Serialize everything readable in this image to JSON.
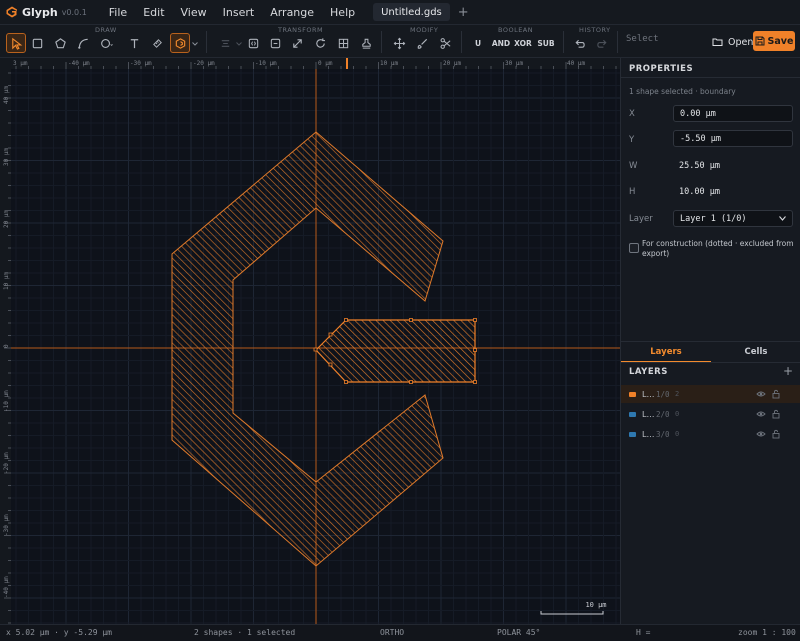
{
  "app": {
    "name": "Glyph",
    "version": "v0.0.1",
    "brand_color": "#f08129",
    "menu": [
      "File",
      "Edit",
      "View",
      "Insert",
      "Arrange",
      "Help"
    ],
    "doc_tab": "Untitled.gds",
    "tab_add": "+"
  },
  "toolbar": {
    "groups": [
      "DRAW",
      "TRANSFORM",
      "MODIFY",
      "BOOLEAN",
      "HISTORY"
    ],
    "boolean_ops": [
      "U",
      "AND",
      "XOR",
      "SUB"
    ],
    "select_label": "Select",
    "open_label": "Open",
    "save_label": "Save"
  },
  "canvas": {
    "x_ruler": [
      "3 µm",
      "-40 µm",
      "-30 µm",
      "-20 µm",
      "-10 µm",
      "0 µm",
      "10 µm",
      "20 µm",
      "30 µm",
      "40 µm"
    ],
    "y_ruler": [
      "40 µm",
      "30 µm",
      "20 µm",
      "10 µm",
      "0",
      "-10 µm",
      "-20 µm",
      "-30 µm",
      "-40 µm"
    ],
    "scale_bar": "10 µm",
    "shape_color": "#e07a2a",
    "axis_color": "#b5591b",
    "background": "#0e121a"
  },
  "properties": {
    "title": "PROPERTIES",
    "subtitle": "1 shape selected · boundary",
    "x_label": "X",
    "x_value": "0.00 µm",
    "y_label": "Y",
    "y_value": "-5.50 µm",
    "w_label": "W",
    "w_value": "25.50 µm",
    "h_label": "H",
    "h_value": "10.00 µm",
    "layer_label": "Layer",
    "layer_value": "Layer 1 (1/0)",
    "construction_label": "For construction (dotted · excluded from export)"
  },
  "layers_panel": {
    "tabs": [
      "Layers",
      "Cells"
    ],
    "title": "LAYERS",
    "add": "+",
    "items": [
      {
        "name": "L…",
        "info": "1/0",
        "count": "2",
        "color": "#f08129"
      },
      {
        "name": "L…",
        "info": "2/0",
        "count": "0",
        "color": "#2e78b0"
      },
      {
        "name": "L…",
        "info": "3/0",
        "count": "0",
        "color": "#2e78b0"
      }
    ]
  },
  "status": {
    "coords": "x 5.02 µm · y -5.29 µm",
    "selection": "2 shapes · 1 selected",
    "ortho": "ORTHO",
    "polar": "POLAR 45°",
    "h": "H =",
    "zoom": "zoom 1 : 100"
  }
}
